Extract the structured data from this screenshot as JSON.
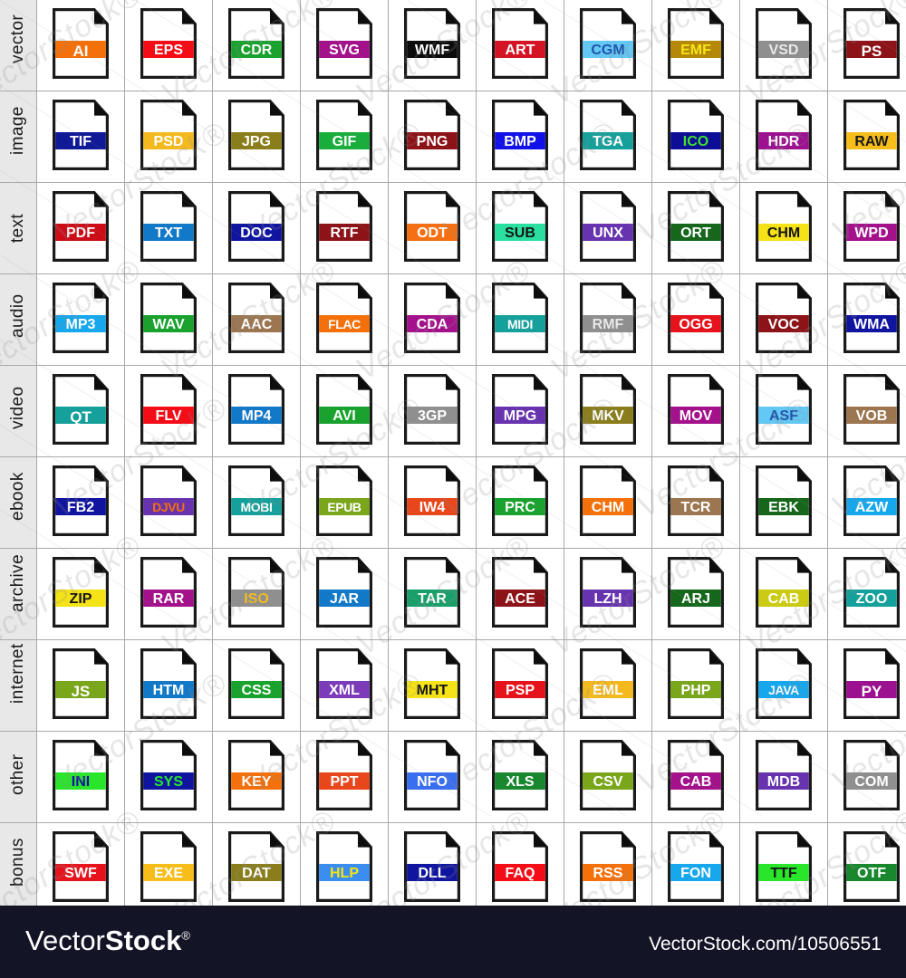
{
  "footer": {
    "logo_thin": "Vector",
    "logo_bold": "Stock",
    "logo_reg": "®",
    "url": "VectorStock.com/10506551",
    "background": "#141427"
  },
  "watermark": {
    "text": "VectorStock",
    "registered": "®"
  },
  "grid": {
    "columns": 10,
    "rows": 10,
    "rows_data": [
      {
        "label": "vector",
        "icons": [
          {
            "ext": "AI",
            "band": "#f4700a",
            "text": "#ffffff"
          },
          {
            "ext": "EPS",
            "band": "#f40c16",
            "text": "#ffffff"
          },
          {
            "ext": "CDR",
            "band": "#19a22e",
            "text": "#ffffff"
          },
          {
            "ext": "SVG",
            "band": "#a3128b",
            "text": "#ffffff"
          },
          {
            "ext": "WMF",
            "band": "#0c0c0c",
            "text": "#ffffff"
          },
          {
            "ext": "ART",
            "band": "#d41424",
            "text": "#ffffff"
          },
          {
            "ext": "CGM",
            "band": "#63c8f4",
            "text": "#2255aa"
          },
          {
            "ext": "EMF",
            "band": "#b5880a",
            "text": "#f5e617"
          },
          {
            "ext": "VSD",
            "band": "#8f8f8f",
            "text": "#e8e8e8"
          },
          {
            "ext": "PS",
            "band": "#8c1419",
            "text": "#ffffff"
          }
        ]
      },
      {
        "label": "image",
        "icons": [
          {
            "ext": "TIF",
            "band": "#101a96",
            "text": "#ffffff"
          },
          {
            "ext": "PSD",
            "band": "#f3b91e",
            "text": "#ffffff"
          },
          {
            "ext": "JPG",
            "band": "#8a7d1b",
            "text": "#ffffff"
          },
          {
            "ext": "GIF",
            "band": "#19ad3c",
            "text": "#ffffff"
          },
          {
            "ext": "PNG",
            "band": "#8c1419",
            "text": "#ffffff"
          },
          {
            "ext": "BMP",
            "band": "#1111e8",
            "text": "#ffffff"
          },
          {
            "ext": "TGA",
            "band": "#16a09b",
            "text": "#ffffff"
          },
          {
            "ext": "ICO",
            "band": "#0d0d96",
            "text": "#3ee32a"
          },
          {
            "ext": "HDR",
            "band": "#9c1190",
            "text": "#ffffff"
          },
          {
            "ext": "RAW",
            "band": "#f6bd1b",
            "text": "#191919"
          }
        ]
      },
      {
        "label": "text",
        "icons": [
          {
            "ext": "PDF",
            "band": "#cc0d17",
            "text": "#ffffff"
          },
          {
            "ext": "TXT",
            "band": "#1278c8",
            "text": "#ffffff"
          },
          {
            "ext": "DOC",
            "band": "#1015a0",
            "text": "#ffffff"
          },
          {
            "ext": "RTF",
            "band": "#8c1419",
            "text": "#ffffff"
          },
          {
            "ext": "ODT",
            "band": "#f47012",
            "text": "#ffffff"
          },
          {
            "ext": "SUB",
            "band": "#2ae0a0",
            "text": "#141414"
          },
          {
            "ext": "UNX",
            "band": "#6733ae",
            "text": "#ffffff"
          },
          {
            "ext": "ORT",
            "band": "#16671c",
            "text": "#ffffff"
          },
          {
            "ext": "CHM",
            "band": "#f5e317",
            "text": "#141414"
          },
          {
            "ext": "WPD",
            "band": "#a3128b",
            "text": "#ffffff"
          }
        ]
      },
      {
        "label": "audio",
        "icons": [
          {
            "ext": "MP3",
            "band": "#16a7ec",
            "text": "#ffffff"
          },
          {
            "ext": "WAV",
            "band": "#19a22e",
            "text": "#ffffff"
          },
          {
            "ext": "AAC",
            "band": "#9c7650",
            "text": "#ffffff"
          },
          {
            "ext": "FLAC",
            "band": "#f4700a",
            "text": "#ffffff"
          },
          {
            "ext": "CDA",
            "band": "#a3128b",
            "text": "#ffffff"
          },
          {
            "ext": "MIDI",
            "band": "#16a09b",
            "text": "#ffffff"
          },
          {
            "ext": "RMF",
            "band": "#8f8f8f",
            "text": "#e8e8e8"
          },
          {
            "ext": "OGG",
            "band": "#e6121c",
            "text": "#ffffff"
          },
          {
            "ext": "VOC",
            "band": "#8c1419",
            "text": "#ffffff"
          },
          {
            "ext": "WMA",
            "band": "#1015a0",
            "text": "#ffffff"
          }
        ]
      },
      {
        "label": "video",
        "icons": [
          {
            "ext": "QT",
            "band": "#16a09b",
            "text": "#ffffff"
          },
          {
            "ext": "FLV",
            "band": "#f40c16",
            "text": "#ffffff"
          },
          {
            "ext": "MP4",
            "band": "#1278c8",
            "text": "#ffffff"
          },
          {
            "ext": "AVI",
            "band": "#19a22e",
            "text": "#ffffff"
          },
          {
            "ext": "3GP",
            "band": "#8f8f8f",
            "text": "#ffffff"
          },
          {
            "ext": "MPG",
            "band": "#6733ae",
            "text": "#ffffff"
          },
          {
            "ext": "MKV",
            "band": "#8a7d1b",
            "text": "#ffffff"
          },
          {
            "ext": "MOV",
            "band": "#a3128b",
            "text": "#ffffff"
          },
          {
            "ext": "ASF",
            "band": "#63c8f4",
            "text": "#2255aa"
          },
          {
            "ext": "VOB",
            "band": "#9c7650",
            "text": "#ffffff"
          }
        ]
      },
      {
        "label": "ebook",
        "icons": [
          {
            "ext": "FB2",
            "band": "#1015a0",
            "text": "#ffffff"
          },
          {
            "ext": "DJVU",
            "band": "#6733ae",
            "text": "#f4700a"
          },
          {
            "ext": "MOBI",
            "band": "#16a09b",
            "text": "#ffffff"
          },
          {
            "ext": "EPUB",
            "band": "#7aa61c",
            "text": "#ffffff"
          },
          {
            "ext": "IW4",
            "band": "#e8471c",
            "text": "#ffffff"
          },
          {
            "ext": "PRC",
            "band": "#19a22e",
            "text": "#ffffff"
          },
          {
            "ext": "CHM",
            "band": "#f4700a",
            "text": "#ffffff"
          },
          {
            "ext": "TCR",
            "band": "#9c7650",
            "text": "#ffffff"
          },
          {
            "ext": "EBK",
            "band": "#16671c",
            "text": "#ffffff"
          },
          {
            "ext": "AZW",
            "band": "#16a7ec",
            "text": "#ffffff"
          }
        ]
      },
      {
        "label": "archive",
        "icons": [
          {
            "ext": "ZIP",
            "band": "#f5e317",
            "text": "#141414"
          },
          {
            "ext": "RAR",
            "band": "#a3128b",
            "text": "#ffffff"
          },
          {
            "ext": "ISO",
            "band": "#8f8f8f",
            "text": "#f6bd1b"
          },
          {
            "ext": "JAR",
            "band": "#1278c8",
            "text": "#ffffff"
          },
          {
            "ext": "TAR",
            "band": "#19a06a",
            "text": "#ffffff"
          },
          {
            "ext": "ACE",
            "band": "#8c1419",
            "text": "#ffffff"
          },
          {
            "ext": "LZH",
            "band": "#6733ae",
            "text": "#ffffff"
          },
          {
            "ext": "ARJ",
            "band": "#16671c",
            "text": "#ffffff"
          },
          {
            "ext": "CAB",
            "band": "#cbcb14",
            "text": "#ffffff"
          },
          {
            "ext": "ZOO",
            "band": "#16a09b",
            "text": "#ffffff"
          }
        ]
      },
      {
        "label": "internet",
        "icons": [
          {
            "ext": "JS",
            "band": "#7aa61c",
            "text": "#ffffff"
          },
          {
            "ext": "HTM",
            "band": "#1278c8",
            "text": "#ffffff"
          },
          {
            "ext": "CSS",
            "band": "#19a22e",
            "text": "#ffffff"
          },
          {
            "ext": "XML",
            "band": "#7c3bb8",
            "text": "#ffffff"
          },
          {
            "ext": "MHT",
            "band": "#f5e317",
            "text": "#141414"
          },
          {
            "ext": "PSP",
            "band": "#e6121c",
            "text": "#ffffff"
          },
          {
            "ext": "EML",
            "band": "#f3b91e",
            "text": "#ffffff"
          },
          {
            "ext": "PHP",
            "band": "#7aa61c",
            "text": "#ffffff"
          },
          {
            "ext": "JAVA",
            "band": "#16a7ec",
            "text": "#ffffff"
          },
          {
            "ext": "PY",
            "band": "#9c1190",
            "text": "#ffffff"
          }
        ]
      },
      {
        "label": "other",
        "icons": [
          {
            "ext": "INI",
            "band": "#29e62b",
            "text": "#1010a0"
          },
          {
            "ext": "SYS",
            "band": "#1015a0",
            "text": "#29e62b"
          },
          {
            "ext": "KEY",
            "band": "#f4700a",
            "text": "#ffffff"
          },
          {
            "ext": "PPT",
            "band": "#e8471c",
            "text": "#ffffff"
          },
          {
            "ext": "NFO",
            "band": "#3a6ef0",
            "text": "#ffffff"
          },
          {
            "ext": "XLS",
            "band": "#19872e",
            "text": "#ffffff"
          },
          {
            "ext": "CSV",
            "band": "#7aa61c",
            "text": "#ffffff"
          },
          {
            "ext": "CAB",
            "band": "#a3128b",
            "text": "#ffffff"
          },
          {
            "ext": "MDB",
            "band": "#6733ae",
            "text": "#ffffff"
          },
          {
            "ext": "COM",
            "band": "#8f8f8f",
            "text": "#ffffff"
          }
        ]
      },
      {
        "label": "bonus",
        "icons": [
          {
            "ext": "SWF",
            "band": "#e6121c",
            "text": "#ffffff"
          },
          {
            "ext": "EXE",
            "band": "#f6bd1b",
            "text": "#ffffff"
          },
          {
            "ext": "DAT",
            "band": "#8a7d1b",
            "text": "#ffffff"
          },
          {
            "ext": "HLP",
            "band": "#3a8ef0",
            "text": "#f5e317"
          },
          {
            "ext": "DLL",
            "band": "#1015a0",
            "text": "#ffffff"
          },
          {
            "ext": "FAQ",
            "band": "#f40c16",
            "text": "#ffffff"
          },
          {
            "ext": "RSS",
            "band": "#f4700a",
            "text": "#ffffff"
          },
          {
            "ext": "FON",
            "band": "#16a7ec",
            "text": "#ffffff"
          },
          {
            "ext": "TTF",
            "band": "#29e62b",
            "text": "#141414"
          },
          {
            "ext": "OTF",
            "band": "#19872e",
            "text": "#ffffff"
          }
        ]
      }
    ]
  }
}
